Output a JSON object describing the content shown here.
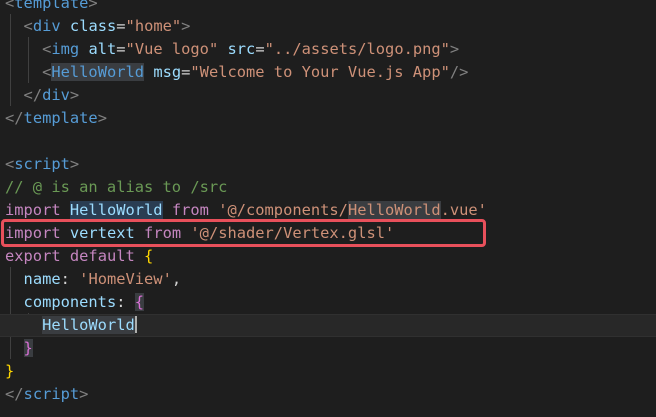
{
  "editor": {
    "lines": [
      {
        "id": "l1",
        "tokens": [
          {
            "t": "<",
            "c": "tok-punc"
          },
          {
            "t": "template",
            "c": "tok-tag"
          },
          {
            "t": ">",
            "c": "tok-punc"
          }
        ]
      },
      {
        "id": "l2",
        "tokens": [
          {
            "t": "  ",
            "c": "tok-text"
          },
          {
            "t": "<",
            "c": "tok-punc"
          },
          {
            "t": "div",
            "c": "tok-tag"
          },
          {
            "t": " ",
            "c": "tok-text"
          },
          {
            "t": "class",
            "c": "tok-attr"
          },
          {
            "t": "=",
            "c": "tok-text"
          },
          {
            "t": "\"home\"",
            "c": "tok-str"
          },
          {
            "t": ">",
            "c": "tok-punc"
          }
        ]
      },
      {
        "id": "l3",
        "tokens": [
          {
            "t": "    ",
            "c": "tok-text"
          },
          {
            "t": "<",
            "c": "tok-punc"
          },
          {
            "t": "img",
            "c": "tok-tag"
          },
          {
            "t": " ",
            "c": "tok-text"
          },
          {
            "t": "alt",
            "c": "tok-attr"
          },
          {
            "t": "=",
            "c": "tok-text"
          },
          {
            "t": "\"Vue logo\"",
            "c": "tok-str"
          },
          {
            "t": " ",
            "c": "tok-text"
          },
          {
            "t": "src",
            "c": "tok-attr"
          },
          {
            "t": "=",
            "c": "tok-text"
          },
          {
            "t": "\"../assets/logo.png\"",
            "c": "tok-str"
          },
          {
            "t": ">",
            "c": "tok-punc"
          }
        ]
      },
      {
        "id": "l4",
        "tokens": [
          {
            "t": "    ",
            "c": "tok-text"
          },
          {
            "t": "<",
            "c": "tok-punc"
          },
          {
            "t": "HelloWorld",
            "c": "tok-tag mark"
          },
          {
            "t": " ",
            "c": "tok-text"
          },
          {
            "t": "msg",
            "c": "tok-attr"
          },
          {
            "t": "=",
            "c": "tok-text"
          },
          {
            "t": "\"Welcome to Your Vue.js App\"",
            "c": "tok-str"
          },
          {
            "t": "/>",
            "c": "tok-punc"
          }
        ]
      },
      {
        "id": "l5",
        "tokens": [
          {
            "t": "  ",
            "c": "tok-text"
          },
          {
            "t": "</",
            "c": "tok-punc"
          },
          {
            "t": "div",
            "c": "tok-tag"
          },
          {
            "t": ">",
            "c": "tok-punc"
          }
        ]
      },
      {
        "id": "l6",
        "tokens": [
          {
            "t": "</",
            "c": "tok-punc"
          },
          {
            "t": "template",
            "c": "tok-tag"
          },
          {
            "t": ">",
            "c": "tok-punc"
          }
        ]
      },
      {
        "id": "l7",
        "tokens": []
      },
      {
        "id": "l8",
        "tokens": [
          {
            "t": "<",
            "c": "tok-punc"
          },
          {
            "t": "script",
            "c": "tok-tag"
          },
          {
            "t": ">",
            "c": "tok-punc"
          }
        ]
      },
      {
        "id": "l9",
        "tokens": [
          {
            "t": "// @ is an alias to /src",
            "c": "tok-comment"
          }
        ]
      },
      {
        "id": "l10",
        "tokens": [
          {
            "t": "import",
            "c": "tok-kw"
          },
          {
            "t": " ",
            "c": "tok-text"
          },
          {
            "t": "HelloWorld",
            "c": "tok-attr mark-blue"
          },
          {
            "t": " ",
            "c": "tok-text"
          },
          {
            "t": "from",
            "c": "tok-kw"
          },
          {
            "t": " ",
            "c": "tok-text"
          },
          {
            "t": "'@/components/",
            "c": "tok-str"
          },
          {
            "t": "HelloWorld",
            "c": "tok-str mark"
          },
          {
            "t": ".vue'",
            "c": "tok-str"
          }
        ]
      },
      {
        "id": "l11",
        "tokens": [
          {
            "t": "import",
            "c": "tok-kw"
          },
          {
            "t": " ",
            "c": "tok-text"
          },
          {
            "t": "vertext",
            "c": "tok-attr"
          },
          {
            "t": " ",
            "c": "tok-text"
          },
          {
            "t": "from",
            "c": "tok-kw"
          },
          {
            "t": " ",
            "c": "tok-text"
          },
          {
            "t": "'@/shader/Vertex.glsl'",
            "c": "tok-str"
          }
        ]
      },
      {
        "id": "l12",
        "tokens": [
          {
            "t": "export",
            "c": "tok-kw"
          },
          {
            "t": " ",
            "c": "tok-text"
          },
          {
            "t": "default",
            "c": "tok-kw"
          },
          {
            "t": " ",
            "c": "tok-text"
          },
          {
            "t": "{",
            "c": "tok-bracket-y"
          }
        ]
      },
      {
        "id": "l13",
        "tokens": [
          {
            "t": "  ",
            "c": "tok-text"
          },
          {
            "t": "name",
            "c": "tok-attr"
          },
          {
            "t": ": ",
            "c": "tok-text"
          },
          {
            "t": "'HomeView'",
            "c": "tok-str"
          },
          {
            "t": ",",
            "c": "tok-text"
          }
        ]
      },
      {
        "id": "l14",
        "tokens": [
          {
            "t": "  ",
            "c": "tok-text"
          },
          {
            "t": "components",
            "c": "tok-attr"
          },
          {
            "t": ": ",
            "c": "tok-text"
          },
          {
            "t": "{",
            "c": "tok-bracket-p mark"
          }
        ]
      },
      {
        "id": "l15",
        "current": true,
        "tokens": [
          {
            "t": "    ",
            "c": "tok-text"
          },
          {
            "t": "HelloWorld",
            "c": "tok-attr mark"
          }
        ]
      },
      {
        "id": "l16",
        "tokens": [
          {
            "t": "  ",
            "c": "tok-text"
          },
          {
            "t": "}",
            "c": "tok-bracket-p mark"
          }
        ]
      },
      {
        "id": "l17",
        "tokens": [
          {
            "t": "}",
            "c": "tok-bracket-y"
          }
        ]
      },
      {
        "id": "l18",
        "tokens": [
          {
            "t": "</",
            "c": "tok-punc"
          },
          {
            "t": "script",
            "c": "tok-tag"
          },
          {
            "t": ">",
            "c": "tok-punc"
          }
        ]
      }
    ]
  },
  "annotation": {
    "highlight_color": "#e8505b"
  }
}
